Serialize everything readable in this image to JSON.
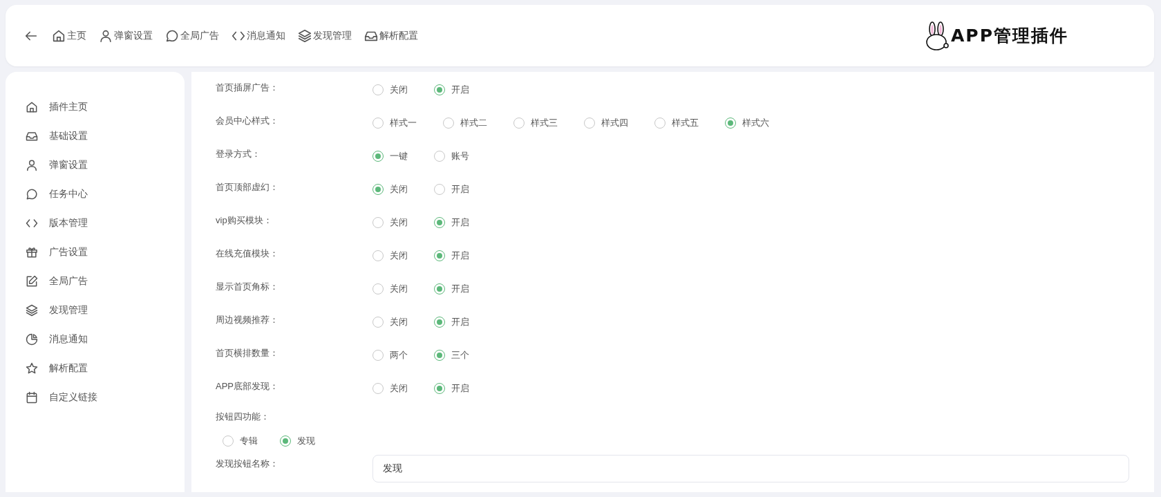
{
  "header": {
    "nav": [
      {
        "label": "主页"
      },
      {
        "label": "弹窗设置"
      },
      {
        "label": "全局广告"
      },
      {
        "label": "消息通知"
      },
      {
        "label": "发现管理"
      },
      {
        "label": "解析配置"
      }
    ],
    "logo": "APP管理插件"
  },
  "sidebar": {
    "items": [
      {
        "label": "插件主页"
      },
      {
        "label": "基础设置"
      },
      {
        "label": "弹窗设置"
      },
      {
        "label": "任务中心"
      },
      {
        "label": "版本管理"
      },
      {
        "label": "广告设置"
      },
      {
        "label": "全局广告"
      },
      {
        "label": "发现管理"
      },
      {
        "label": "消息通知"
      },
      {
        "label": "解析配置"
      },
      {
        "label": "自定义链接"
      }
    ]
  },
  "settings": [
    {
      "kind": "radio",
      "label": "首页插屏广告：",
      "options": [
        {
          "label": "关闭",
          "selected": false
        },
        {
          "label": "开启",
          "selected": true
        }
      ]
    },
    {
      "kind": "radio",
      "label": "会员中心样式：",
      "options": [
        {
          "label": "样式一",
          "selected": false
        },
        {
          "label": "样式二",
          "selected": false
        },
        {
          "label": "样式三",
          "selected": false
        },
        {
          "label": "样式四",
          "selected": false
        },
        {
          "label": "样式五",
          "selected": false
        },
        {
          "label": "样式六",
          "selected": true
        }
      ]
    },
    {
      "kind": "radio",
      "label": "登录方式：",
      "options": [
        {
          "label": "一键",
          "selected": true
        },
        {
          "label": "账号",
          "selected": false
        }
      ]
    },
    {
      "kind": "radio",
      "label": "首页顶部虚幻：",
      "options": [
        {
          "label": "关闭",
          "selected": true
        },
        {
          "label": "开启",
          "selected": false
        }
      ]
    },
    {
      "kind": "radio",
      "label": "vip购买模块：",
      "options": [
        {
          "label": "关闭",
          "selected": false
        },
        {
          "label": "开启",
          "selected": true
        }
      ]
    },
    {
      "kind": "radio",
      "label": "在线充值模块：",
      "options": [
        {
          "label": "关闭",
          "selected": false
        },
        {
          "label": "开启",
          "selected": true
        }
      ]
    },
    {
      "kind": "radio",
      "label": "显示首页角标：",
      "options": [
        {
          "label": "关闭",
          "selected": false
        },
        {
          "label": "开启",
          "selected": true
        }
      ]
    },
    {
      "kind": "radio",
      "label": "周边视频推荐：",
      "options": [
        {
          "label": "关闭",
          "selected": false
        },
        {
          "label": "开启",
          "selected": true
        }
      ]
    },
    {
      "kind": "radio",
      "label": "首页横排数量：",
      "options": [
        {
          "label": "两个",
          "selected": false
        },
        {
          "label": "三个",
          "selected": true
        }
      ]
    },
    {
      "kind": "radio",
      "label": "APP底部发现：",
      "options": [
        {
          "label": "关闭",
          "selected": false
        },
        {
          "label": "开启",
          "selected": true
        }
      ]
    },
    {
      "kind": "radio-block",
      "label": "按钮四功能：",
      "options": [
        {
          "label": "专辑",
          "selected": false
        },
        {
          "label": "发现",
          "selected": true
        }
      ]
    },
    {
      "kind": "input",
      "label": "发现按钮名称：",
      "value": "发现"
    }
  ]
}
